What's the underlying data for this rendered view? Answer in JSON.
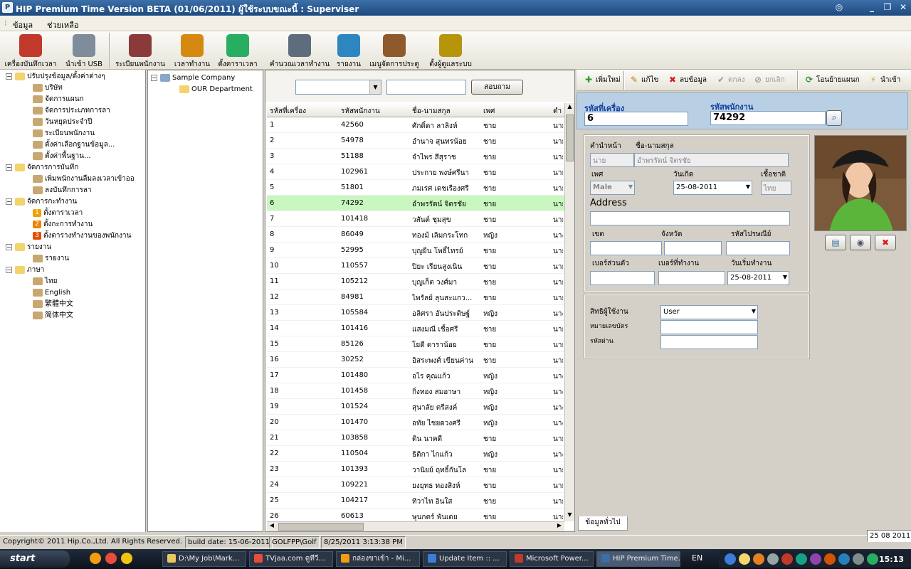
{
  "window": {
    "title": "HIP Premium Time Version BETA (01/06/2011)  ผู้ใช้ระบบขณะนี้ : Superviser"
  },
  "menu": [
    "ข้อมูล",
    "ช่วยเหลือ"
  ],
  "toolbar": [
    {
      "label": "เครื่องบันทึกเวลา",
      "icon": "clock-device-icon",
      "color": "#c0392b"
    },
    {
      "label": "นำเข้า USB",
      "icon": "usb-icon",
      "color": "#7f8c9a"
    },
    {
      "label": "ระเบียนพนักงาน",
      "icon": "people-icon",
      "color": "#8b3a3a"
    },
    {
      "label": "เวลาทำงาน",
      "icon": "stopwatch-icon",
      "color": "#d68910"
    },
    {
      "label": "ตั้งตาราเวลา",
      "icon": "calendar-icon",
      "color": "#27ae60"
    },
    {
      "label": "คำนวณเวลาทำงาน",
      "icon": "calculate-icon",
      "color": "#5d6d7e"
    },
    {
      "label": "รายงาน",
      "icon": "report-icon",
      "color": "#2e86c1"
    },
    {
      "label": "เมนูจัดการประตู",
      "icon": "door-icon",
      "color": "#8e5a2b"
    },
    {
      "label": "ตั้งผู้ดูแลระบบ",
      "icon": "admin-lock-icon",
      "color": "#b7950b"
    }
  ],
  "tree": [
    {
      "label": "ปรับปรุงข้อมูล/ตั้งค่าต่างๆ",
      "level": 0
    },
    {
      "label": "บริษัท",
      "level": 1
    },
    {
      "label": "จัดการแผนก",
      "level": 1
    },
    {
      "label": "จัดการประเภทการลา",
      "level": 1
    },
    {
      "label": "วันหยุดประจำปี",
      "level": 1
    },
    {
      "label": "ระเบียนพนักงาน",
      "level": 1
    },
    {
      "label": "ตั้งค่าเลือกฐานข้อมูล...",
      "level": 1
    },
    {
      "label": "ตั้งค่าพื้นฐาน...",
      "level": 1
    },
    {
      "label": "จัดการการบันทึก",
      "level": 0
    },
    {
      "label": "เพิ่มพนักงานลืมลงเวลาเข้าออ",
      "level": 1
    },
    {
      "label": "ลงบันทึกการลา",
      "level": 1
    },
    {
      "label": "จัดการกะทำงาน",
      "level": 0
    },
    {
      "label": "ตั้งตาราเวลา",
      "level": 1,
      "num": "1"
    },
    {
      "label": "ตั้งกะการทำงาน",
      "level": 1,
      "num": "2"
    },
    {
      "label": "ตั้งตารางทำงานของพนักงาน",
      "level": 1,
      "num": "3"
    },
    {
      "label": "รายงาน",
      "level": 0
    },
    {
      "label": "รายงาน",
      "level": 1
    },
    {
      "label": "ภาษา",
      "level": 0
    },
    {
      "label": "ไทย",
      "level": 1
    },
    {
      "label": "English",
      "level": 1
    },
    {
      "label": "繁體中文",
      "level": 1
    },
    {
      "label": "简体中文",
      "level": 1
    }
  ],
  "company": {
    "name": "Sample Company",
    "dept": "OUR Department"
  },
  "filter": {
    "search_btn": "สอบถาม",
    "combo_value": "",
    "text_value": ""
  },
  "grid": {
    "headers": [
      "รหัสที่เครื่อง",
      "รหัสพนักงาน",
      "ชื่อ-นามสกุล",
      "เพศ",
      "ตำ"
    ],
    "rows": [
      [
        "1",
        "42560",
        "ศักดิ์ดา ลาลิงห์",
        "ชาย",
        "นาย"
      ],
      [
        "2",
        "54978",
        "อำนาจ สุนทรน้อย",
        "ชาย",
        "นาย"
      ],
      [
        "3",
        "51188",
        "จำไพร สีสุราช",
        "ชาย",
        "นาย"
      ],
      [
        "4",
        "102961",
        "ประกาย พงษ์ศรีนา",
        "ชาย",
        "นาย"
      ],
      [
        "5",
        "51801",
        "ภมเรศ เดชเรืองศรี",
        "ชาย",
        "นาย"
      ],
      [
        "6",
        "74292",
        "อำพรรัตน์ จิตรชัย",
        "ชาย",
        "นาย"
      ],
      [
        "7",
        "101418",
        "วสันต์ ชุมสุข",
        "ชาย",
        "นาย"
      ],
      [
        "8",
        "86049",
        "ทองม้ เลิมกระโทก",
        "หญิง",
        "นาง"
      ],
      [
        "9",
        "52995",
        "บุญยืน โพธิ์ไทรย์",
        "ชาย",
        "นาย"
      ],
      [
        "10",
        "110557",
        "ปิยะ เรียนสูงเนิน",
        "ชาย",
        "นาย"
      ],
      [
        "11",
        "105212",
        "บุญเก็ต วงศ์มา",
        "ชาย",
        "นาย"
      ],
      [
        "12",
        "84981",
        "ไพรัลย์ ลุนสะแกว...",
        "ชาย",
        "นาย"
      ],
      [
        "13",
        "105584",
        "อลิศรา อันประดิษฐ์",
        "หญิง",
        "นาง"
      ],
      [
        "14",
        "101416",
        "แสงมณี เชื้อศรี",
        "ชาย",
        "นาย"
      ],
      [
        "15",
        "85126",
        "โยดี ดาราน้อย",
        "ชาย",
        "นาย"
      ],
      [
        "16",
        "30252",
        "อิสระพงศ์ เขียนค่าน",
        "ชาย",
        "นาย"
      ],
      [
        "17",
        "101480",
        "อไร คุณแก้ว",
        "หญิง",
        "นาง"
      ],
      [
        "18",
        "101458",
        "กิ่งทอง สมอาษา",
        "หญิง",
        "นาง"
      ],
      [
        "19",
        "101524",
        "สุนาลัย ตรีสงค์",
        "หญิง",
        "นาง"
      ],
      [
        "20",
        "101470",
        "อทัย ไชยดวงศรี",
        "หญิง",
        "นาง"
      ],
      [
        "21",
        "103858",
        "ดิน นาคดี",
        "ชาย",
        "นาย"
      ],
      [
        "22",
        "110504",
        "ธิติกา ไกแก้ว",
        "หญิง",
        "นาง"
      ],
      [
        "23",
        "101393",
        "วานิยย์ ฤทธิ์กันโล",
        "ชาย",
        "นาย"
      ],
      [
        "24",
        "109221",
        "ยงยุทธ ทองสิงห์",
        "ชาย",
        "นาย"
      ],
      [
        "25",
        "104217",
        "ทิวาไท อินใส",
        "ชาย",
        "นาย"
      ],
      [
        "26",
        "60613",
        "ษุนกตร์ พันเดย",
        "ชาย",
        "นาย"
      ]
    ]
  },
  "detail_toolbar": [
    {
      "label": "เพิ่มใหม่",
      "icon": "add-icon",
      "color": "#2e9c2e",
      "enabled": true
    },
    {
      "label": "แก้ไข",
      "icon": "edit-icon",
      "color": "#c97a10",
      "enabled": true
    },
    {
      "label": "ลบข้อมูล",
      "icon": "delete-icon",
      "color": "#d02020",
      "enabled": true
    },
    {
      "label": "ตกลง",
      "icon": "check-icon",
      "color": "#9a9a9a",
      "enabled": false
    },
    {
      "label": "ยกเลิก",
      "icon": "cancel-icon",
      "color": "#9a9a9a",
      "enabled": false
    },
    {
      "label": "โอนย้ายแผนก",
      "icon": "transfer-icon",
      "color": "#3a8a3a",
      "enabled": true
    },
    {
      "label": "นำเข้า",
      "icon": "import-icon",
      "color": "#d4a010",
      "enabled": true
    }
  ],
  "detail": {
    "machine_id_label": "รหัสที่เครื่อง",
    "machine_id": "6",
    "emp_id_label": "รหัสพนักงาน",
    "emp_id": "74292",
    "prefix_label": "คำนำหน้า",
    "prefix": "นาย",
    "name_label": "ชื่อ-นามสกุล",
    "name": "อำพรรัตน์ จิตรชัย",
    "sex_label": "เพศ",
    "sex": "Male",
    "birth_label": "วันเกิด",
    "birth": "25-08-2011",
    "nation_label": "เชื้อชาติ",
    "nation": "ไทย",
    "address_label": "Address",
    "address": "",
    "district_label": "เขต",
    "district": "",
    "province_label": "จังหวัด",
    "province": "",
    "zip_label": "รหัสไปรษณีย์",
    "zip": "",
    "mobile_label": "เบอร์ส่วนตัว",
    "mobile": "",
    "work_phone_label": "เบอร์ที่ทำงาน",
    "work_phone": "",
    "start_label": "วันเริ่มทำงาน",
    "start": "25-08-2011",
    "role_label": "สิทธิผู้ใช้งาน",
    "role": "User",
    "card_label": "หมายเลขบัตร",
    "card": "",
    "pass_label": "รหัสผ่าน",
    "pass": "",
    "tab": "ข้อมูลทั่วไป"
  },
  "status": {
    "copyright": "Copyright© 2011 Hip.Co.,Ltd. All Rights Reserved.",
    "build": "build date: 15-06-2011",
    "user": "GOLFPP\\Golf",
    "datetime": "8/25/2011 3:13:38 PM",
    "date_right": "25 08 2011"
  },
  "taskbar": {
    "start": "start",
    "tasks": [
      "D:\\My Job\\Mark...",
      "TVjaa.com ดูทีวี...",
      "กล่องขาเข้า - Mi...",
      "Update Item :: ...",
      "Microsoft Power...",
      "HIP Premium Time..."
    ],
    "lang": "EN",
    "clock": "15:13"
  }
}
